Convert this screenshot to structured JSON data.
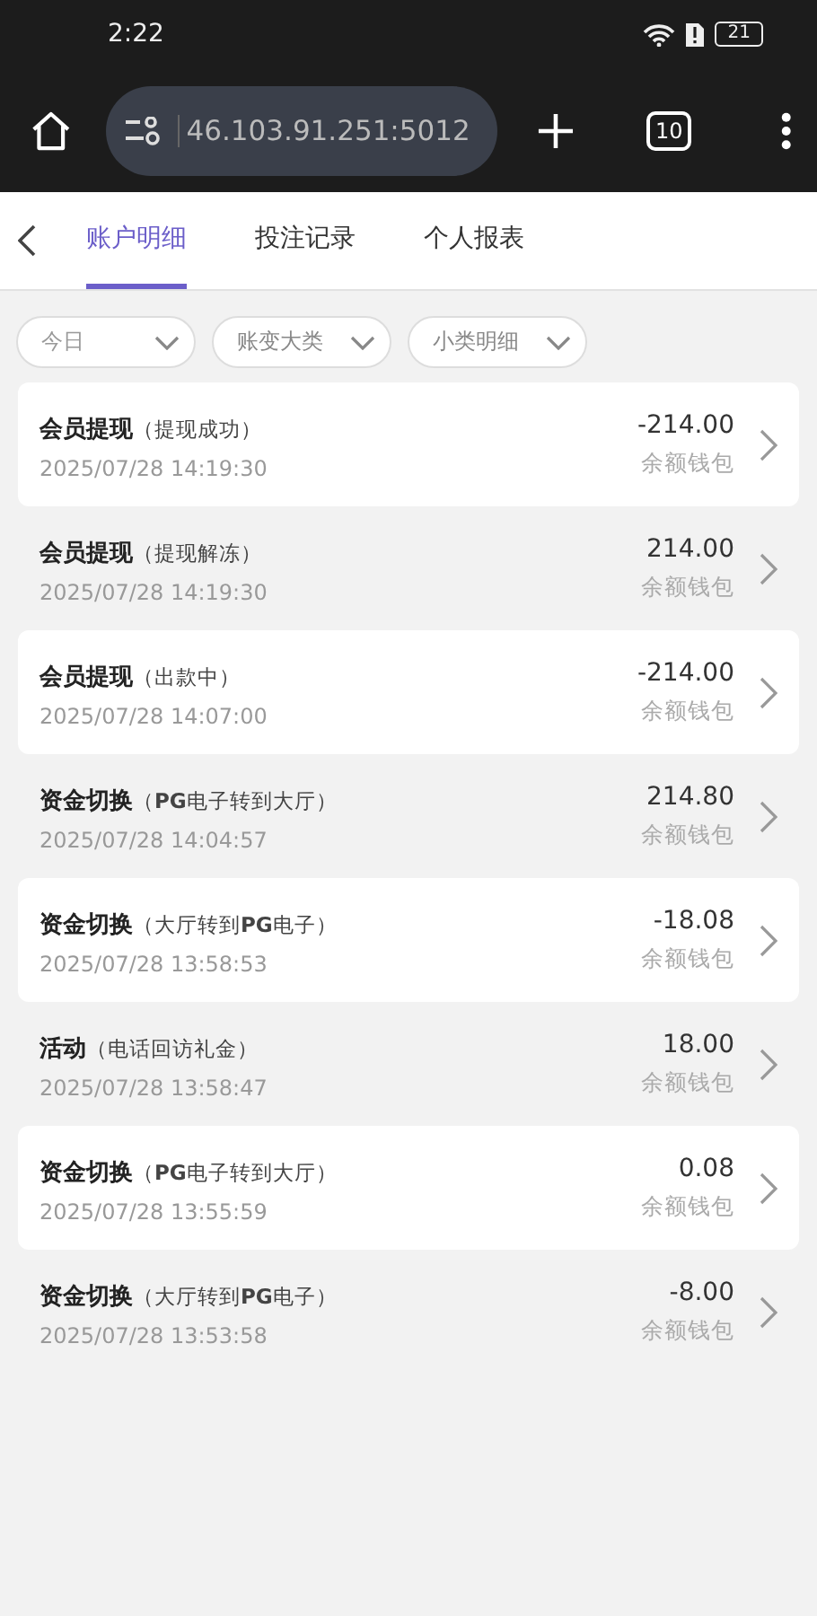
{
  "status_bar": {
    "time": "2:22",
    "battery": "21"
  },
  "browser": {
    "url": "46.103.91.251:5012",
    "tab_count": "10"
  },
  "tabs": [
    {
      "label": "账户明细",
      "selected": true
    },
    {
      "label": "投注记录",
      "selected": false
    },
    {
      "label": "个人报表",
      "selected": false
    }
  ],
  "filters": [
    {
      "label": "今日"
    },
    {
      "label": "账变大类"
    },
    {
      "label": "小类明细"
    }
  ],
  "records": [
    {
      "title": "会员提现",
      "detail": "（提现成功）",
      "time": "2025/07/28 14:19:30",
      "amount": "-214.00",
      "wallet": "余额钱包"
    },
    {
      "title": "会员提现",
      "detail": "（提现解冻）",
      "time": "2025/07/28 14:19:30",
      "amount": "214.00",
      "wallet": "余额钱包"
    },
    {
      "title": "会员提现",
      "detail": "（出款中）",
      "time": "2025/07/28 14:07:00",
      "amount": "-214.00",
      "wallet": "余额钱包"
    },
    {
      "title": "资金切换",
      "detail": "（**PG**电子转到大厅）",
      "time": "2025/07/28 14:04:57",
      "amount": "214.80",
      "wallet": "余额钱包"
    },
    {
      "title": "资金切换",
      "detail": "（大厅转到**PG**电子）",
      "time": "2025/07/28 13:58:53",
      "amount": "-18.08",
      "wallet": "余额钱包"
    },
    {
      "title": "活动",
      "detail": "（电话回访礼金）",
      "time": "2025/07/28 13:58:47",
      "amount": "18.00",
      "wallet": "余额钱包"
    },
    {
      "title": "资金切换",
      "detail": "（**PG**电子转到大厅）",
      "time": "2025/07/28 13:55:59",
      "amount": "0.08",
      "wallet": "余额钱包"
    },
    {
      "title": "资金切换",
      "detail": "（大厅转到**PG**电子）",
      "time": "2025/07/28 13:53:58",
      "amount": "-8.00",
      "wallet": "余额钱包"
    }
  ]
}
